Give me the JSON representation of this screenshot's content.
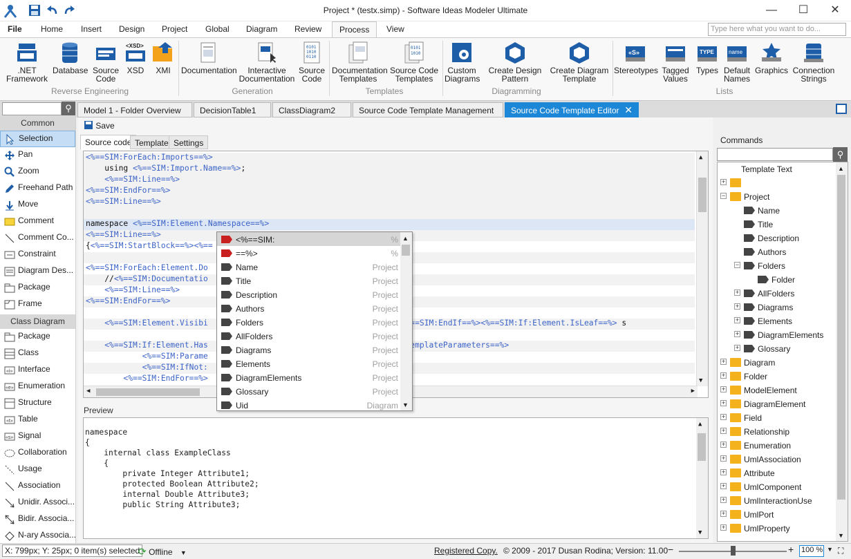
{
  "window": {
    "title": "Project * (testx.simp) - Software Ideas Modeler Ultimate",
    "minimize": "—",
    "maximize": "☐",
    "close": "✕"
  },
  "menu": {
    "file": "File",
    "home": "Home",
    "insert": "Insert",
    "design": "Design",
    "project": "Project",
    "global": "Global",
    "diagram": "Diagram",
    "review": "Review",
    "process": "Process",
    "view": "View",
    "search_placeholder": "Type here what you want to do..."
  },
  "ribbon": {
    "net_framework": ".NET Framework",
    "database": "Database",
    "source_code": "Source Code",
    "xsd": "XSD",
    "xsd_tag": "<XSD>",
    "xmi": "XMI",
    "documentation": "Documentation",
    "interactive_documentation": "Interactive Documentation",
    "source_code2": "Source Code",
    "documentation_templates": "Documentation Templates",
    "source_code_templates": "Source Code Templates",
    "custom_diagrams": "Custom Diagrams",
    "create_design_pattern": "Create Design Pattern",
    "create_diagram_template": "Create Diagram Template",
    "stereotypes": "Stereotypes",
    "stereotypes_tag": "«S»",
    "tagged_values": "Tagged Values",
    "types": "Types",
    "types_tag": "TYPE",
    "default_names": "Default Names",
    "default_names_tag": "name",
    "graphics": "Graphics",
    "connection_strings": "Connection Strings",
    "group_reverse": "Reverse Engineering",
    "group_generation": "Generation",
    "group_templates": "Templates",
    "group_diagramming": "Diagramming",
    "group_lists": "Lists"
  },
  "doc_tabs": [
    "Model 1 - Folder Overview",
    "DecisionTable1",
    "ClassDiagram2",
    "Source Code Template Management",
    "Source Code Template Editor"
  ],
  "toolbox": {
    "common_header": "Common",
    "common": [
      "Selection",
      "Pan",
      "Zoom",
      "Freehand Path",
      "Move",
      "Comment",
      "Comment Co...",
      "Constraint",
      "Diagram Des...",
      "Package",
      "Frame"
    ],
    "class_header": "Class Diagram",
    "class": [
      "Package",
      "Class",
      "Interface",
      "Enumeration",
      "Structure",
      "Table",
      "Signal",
      "Collaboration",
      "Usage",
      "Association",
      "Unidir. Associ...",
      "Bidir. Associa...",
      "N-ary Associa..."
    ]
  },
  "editor": {
    "save": "Save",
    "tabs": [
      "Source code",
      "Template",
      "Settings"
    ],
    "lines": [
      "<%==SIM:ForEach:Imports==%>",
      "    using <%==SIM:Import.Name==%>;",
      "    <%==SIM:Line==%>",
      "<%==SIM:EndFor==%>",
      "<%==SIM:Line==%>",
      "",
      "namespace <%==SIM:Element.Namespace==%>",
      "<%==SIM:Line==%>",
      "{<%==SIM:StartBlock==%><%==",
      "",
      "<%==SIM:ForEach:Element.Do",
      "    //<%==SIM:Documentatio",
      "    <%==SIM:Line==%>",
      "<%==SIM:EndFor==%>",
      "",
      "    <%==SIM:Element.Visibi                                 > static<%==SIM:EndIf==%><%==SIM:If:Element.IsLeaf==%> s",
      "",
      "    <%==SIM:If:Element.Has                                 :Element.TemplateParameters==%>",
      "            <%==SIM:Parame",
      "            <%==SIM:IfNot:",
      "        <%==SIM:EndFor==%>"
    ],
    "autocomplete": [
      {
        "name": "<%==SIM:",
        "cat": "%"
      },
      {
        "name": "==%>",
        "cat": "%"
      },
      {
        "name": "Name",
        "cat": "Project"
      },
      {
        "name": "Title",
        "cat": "Project"
      },
      {
        "name": "Description",
        "cat": "Project"
      },
      {
        "name": "Authors",
        "cat": "Project"
      },
      {
        "name": "Folders",
        "cat": "Project"
      },
      {
        "name": "AllFolders",
        "cat": "Project"
      },
      {
        "name": "Diagrams",
        "cat": "Project"
      },
      {
        "name": "Elements",
        "cat": "Project"
      },
      {
        "name": "DiagramElements",
        "cat": "Project"
      },
      {
        "name": "Glossary",
        "cat": "Project"
      },
      {
        "name": "Uid",
        "cat": "Diagram"
      }
    ],
    "preview_label": "Preview",
    "preview_lines": [
      "namespace",
      "{",
      "    internal class ExampleClass",
      "    {",
      "        private Integer Attribute1;",
      "        protected Boolean Attribute2;",
      "        internal Double Attribute3;",
      "        public String Attribute3;"
    ]
  },
  "commands": {
    "label": "Commands",
    "tree": [
      {
        "label": "Template Text",
        "depth": 0,
        "icon": "none",
        "exp": ""
      },
      {
        "label": "",
        "depth": 0,
        "icon": "folder",
        "exp": "+"
      },
      {
        "label": "Project",
        "depth": 0,
        "icon": "folder",
        "exp": "−"
      },
      {
        "label": "Name",
        "depth": 1,
        "icon": "tag",
        "exp": ""
      },
      {
        "label": "Title",
        "depth": 1,
        "icon": "tag",
        "exp": ""
      },
      {
        "label": "Description",
        "depth": 1,
        "icon": "tag",
        "exp": ""
      },
      {
        "label": "Authors",
        "depth": 1,
        "icon": "tag",
        "exp": ""
      },
      {
        "label": "Folders",
        "depth": 1,
        "icon": "tag",
        "exp": "−"
      },
      {
        "label": "Folder",
        "depth": 2,
        "icon": "tag",
        "exp": ""
      },
      {
        "label": "AllFolders",
        "depth": 1,
        "icon": "tag",
        "exp": "+"
      },
      {
        "label": "Diagrams",
        "depth": 1,
        "icon": "tag",
        "exp": "+"
      },
      {
        "label": "Elements",
        "depth": 1,
        "icon": "tag",
        "exp": "+"
      },
      {
        "label": "DiagramElements",
        "depth": 1,
        "icon": "tag",
        "exp": "+"
      },
      {
        "label": "Glossary",
        "depth": 1,
        "icon": "tag",
        "exp": "+"
      },
      {
        "label": "Diagram",
        "depth": 0,
        "icon": "folder",
        "exp": "+"
      },
      {
        "label": "Folder",
        "depth": 0,
        "icon": "folder",
        "exp": "+"
      },
      {
        "label": "ModelElement",
        "depth": 0,
        "icon": "folder",
        "exp": "+"
      },
      {
        "label": "DiagramElement",
        "depth": 0,
        "icon": "folder",
        "exp": "+"
      },
      {
        "label": "Field",
        "depth": 0,
        "icon": "folder",
        "exp": "+"
      },
      {
        "label": "Relationship",
        "depth": 0,
        "icon": "folder",
        "exp": "+"
      },
      {
        "label": "Enumeration",
        "depth": 0,
        "icon": "folder",
        "exp": "+"
      },
      {
        "label": "UmlAssociation",
        "depth": 0,
        "icon": "folder",
        "exp": "+"
      },
      {
        "label": "Attribute",
        "depth": 0,
        "icon": "folder",
        "exp": "+"
      },
      {
        "label": "UmlComponent",
        "depth": 0,
        "icon": "folder",
        "exp": "+"
      },
      {
        "label": "UmlInteractionUse",
        "depth": 0,
        "icon": "folder",
        "exp": "+"
      },
      {
        "label": "UmlPort",
        "depth": 0,
        "icon": "folder",
        "exp": "+"
      },
      {
        "label": "UmlProperty",
        "depth": 0,
        "icon": "folder",
        "exp": "+"
      }
    ]
  },
  "status": {
    "coords": "X: 799px; Y: 25px; 0 item(s) selected",
    "offline": "Offline",
    "registered": "Registered Copy.",
    "copyright": "© 2009 - 2017 Dusan Rodina; Version: 11.00",
    "zoom": "100 %",
    "zoom_level": 1.0
  },
  "colors": {
    "accent": "#1c87d6",
    "keyword": "#3b63c8",
    "folder": "#f4b21c",
    "tag_red": "#c8201e"
  }
}
